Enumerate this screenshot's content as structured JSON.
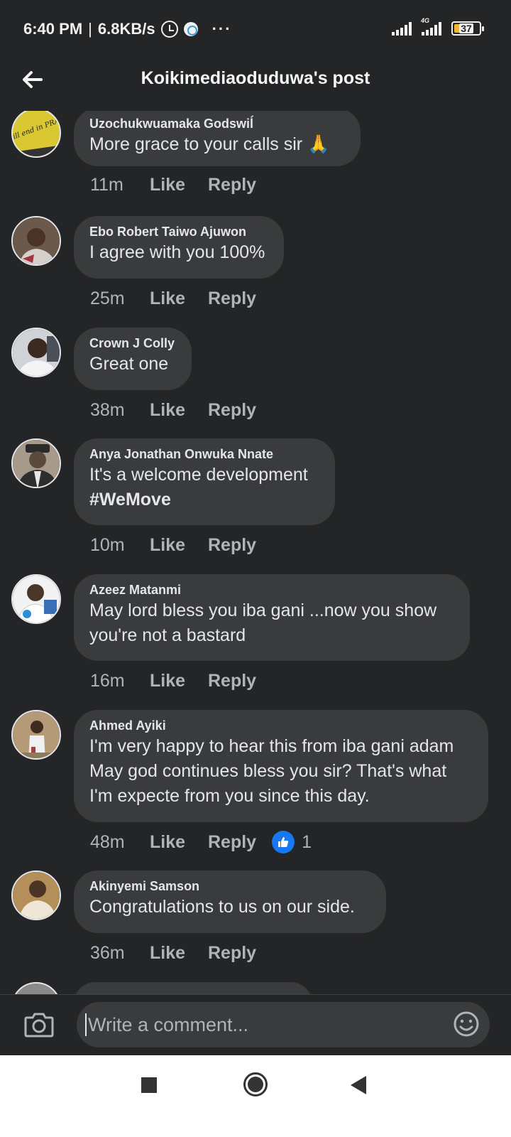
{
  "status_bar": {
    "time": "6:40 PM",
    "separator": "|",
    "speed": "6.8KB/s",
    "more": "···",
    "network_label": "4G",
    "battery": "37"
  },
  "header": {
    "title": "Koikimediaoduduwa's post"
  },
  "actions": {
    "like": "Like",
    "reply": "Reply"
  },
  "comments": [
    {
      "author": "Uzochukwuamaka Godswiĺ",
      "text": "More grace to your calls sir 🙏",
      "time": "11m"
    },
    {
      "author": "Ebo Robert Taiwo Ajuwon",
      "text": "I agree with you 100%",
      "time": "25m"
    },
    {
      "author": "Crown J Colly",
      "text": "Great one",
      "time": "38m"
    },
    {
      "author": "Anya Jonathan Onwuka Nnate",
      "text": "It's a welcome development",
      "hashtag": "#WeMove",
      "time": "10m"
    },
    {
      "author": "Azeez Matanmi",
      "text_line1": "May lord bless you iba gani ...now you show",
      "text_line2": "you're not a bastard",
      "time": "16m"
    },
    {
      "author": "Ahmed Ayiki",
      "text_line1": "I'm very happy to hear this from iba gani adam",
      "text_line2": "May god continues bless you sir? That's what",
      "text_line3": "I'm expecte from you since this day.",
      "time": "48m",
      "reaction_count": "1"
    },
    {
      "author": "Akinyemi Samson",
      "text": "Congratulations to us on our side.",
      "time": "36m"
    }
  ],
  "avatar_1_caption": "It will end in PRAISE",
  "composer": {
    "placeholder": "Write a comment..."
  },
  "colors": {
    "background": "#242526",
    "bubble": "#3a3b3c",
    "like_blue": "#1877f2"
  }
}
